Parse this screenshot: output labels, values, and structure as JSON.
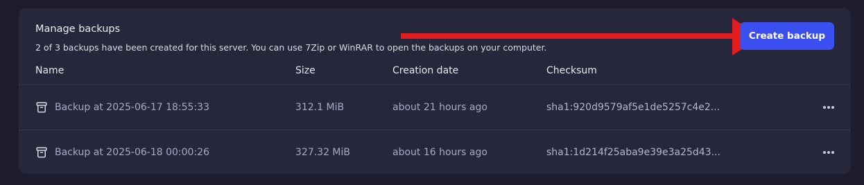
{
  "header": {
    "title": "Manage backups",
    "subtitle": "2 of 3 backups have been created for this server. You can use 7Zip or WinRAR to open the backups on your computer."
  },
  "create_button_label": "Create backup",
  "columns": [
    "Name",
    "Size",
    "Creation date",
    "Checksum"
  ],
  "backups": [
    {
      "name": "Backup at 2025-06-17 18:55:33",
      "size": "312.1 MiB",
      "created": "about 21 hours ago",
      "checksum": "sha1:920d9579af5e1de5257c4e2..."
    },
    {
      "name": "Backup at 2025-06-18 00:00:26",
      "size": "327.32 MiB",
      "created": "about 16 hours ago",
      "checksum": "sha1:1d214f25aba9e39e3a25d43..."
    }
  ],
  "icons": {
    "row_icon": "archive-icon",
    "row_menu": "more-horizontal-icon",
    "annotation": "red-arrow"
  },
  "colors": {
    "page_bg": "#1c1c2e",
    "card_bg": "#26273a",
    "accent": "#3b4ef0",
    "annotation": "#e11d1d"
  }
}
